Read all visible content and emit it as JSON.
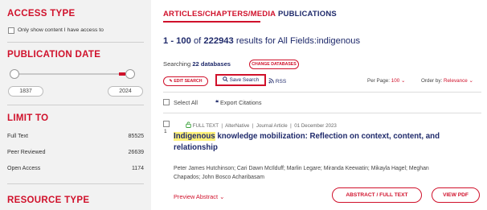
{
  "sidebar": {
    "access_type": {
      "heading": "ACCESS TYPE",
      "checkbox_label": "Only show content I have access to"
    },
    "publication_date": {
      "heading": "PUBLICATION DATE",
      "year_from": "1837",
      "year_to": "2024"
    },
    "limit_to": {
      "heading": "LIMIT TO",
      "items": [
        {
          "label": "Full Text",
          "count": "85525"
        },
        {
          "label": "Peer Reviewed",
          "count": "26639"
        },
        {
          "label": "Open Access",
          "count": "1174"
        }
      ]
    },
    "resource_type": {
      "heading": "RESOURCE TYPE"
    }
  },
  "tabs": {
    "active": "ARTICLES/CHAPTERS/MEDIA",
    "inactive": "PUBLICATIONS"
  },
  "results": {
    "range": "1 - 100",
    "of": "of",
    "total": "222943",
    "suffix": "results for All Fields:indigenous"
  },
  "searching": {
    "prefix": "Searching",
    "databases": "22 databases",
    "change_button": "CHANGE DATABASES"
  },
  "toolbar": {
    "edit_search": "EDIT SEARCH",
    "save_search": "Save Search",
    "rss": "RSS",
    "per_page_label": "Per Page:",
    "per_page_value": "100",
    "order_by_label": "Order by:",
    "order_by_value": "Relevance"
  },
  "list_controls": {
    "select_all": "Select All",
    "export": "Export Citations"
  },
  "result_item": {
    "number": "1",
    "access": "FULL TEXT",
    "source": "AlterNative",
    "type": "Journal Article",
    "date": "01 December 2023",
    "title_highlight": "Indigenous",
    "title_rest": " knowledge mobilization: Reflection on context, content, and relationship",
    "authors": "Peter James Hutchinson; Cari Dawn McIlduff; Marlin Legare; Miranda Keewatin; Mikayla Hagel; Meghan Chapados; John Bosco Acharibasam",
    "preview": "Preview Abstract",
    "abstract_button": "ABSTRACT / FULL TEXT",
    "pdf_button": "VIEW PDF"
  },
  "colors": {
    "accent": "#d0112b",
    "navy": "#1f2a6b",
    "highlight": "#fff27a"
  }
}
